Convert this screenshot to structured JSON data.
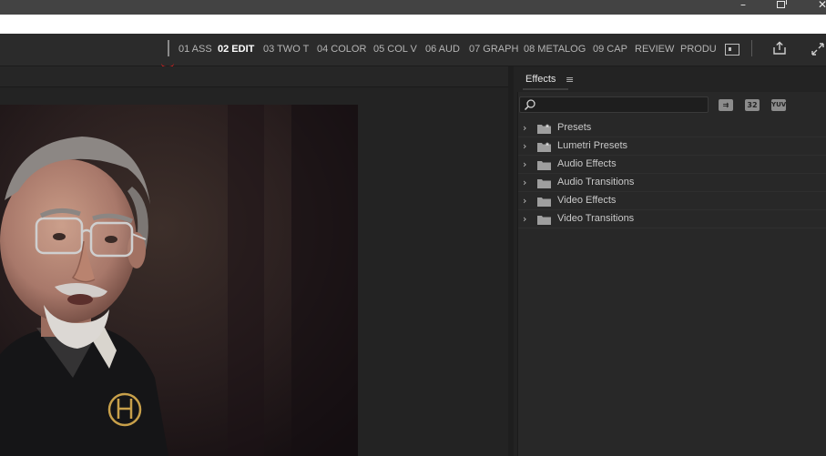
{
  "window": {
    "minimize_icon": "minimize-icon",
    "restore_icon": "restore-icon",
    "close_icon": "close-icon"
  },
  "workspaces": {
    "tabs": [
      {
        "label": "01 ASS",
        "active": false
      },
      {
        "label": "02 EDIT",
        "active": true
      },
      {
        "label": "03 TWO T",
        "active": false
      },
      {
        "label": "04 COLOR",
        "active": false
      },
      {
        "label": "05 COL V",
        "active": false
      },
      {
        "label": "06 AUD",
        "active": false
      },
      {
        "label": "07 GRAPH",
        "active": false
      },
      {
        "label": "08 METALOG",
        "active": false
      },
      {
        "label": "09 CAP",
        "active": false
      },
      {
        "label": "REVIEW",
        "active": false
      },
      {
        "label": "PRODU",
        "active": false
      }
    ],
    "accent_color": "#d81e1e"
  },
  "effects_panel": {
    "title": "Effects",
    "menu_glyph": "≡",
    "search": {
      "value": "",
      "placeholder": ""
    },
    "buttons": [
      {
        "name": "accelerated-effects-button",
        "label": "⇉"
      },
      {
        "name": "32bit-effects-button",
        "label": "32"
      },
      {
        "name": "yuv-effects-button",
        "label": "YUV"
      }
    ],
    "items": [
      {
        "label": "Presets",
        "icon": "preset-folder-icon"
      },
      {
        "label": "Lumetri Presets",
        "icon": "preset-folder-icon"
      },
      {
        "label": "Audio Effects",
        "icon": "folder-icon"
      },
      {
        "label": "Audio Transitions",
        "icon": "folder-icon"
      },
      {
        "label": "Video Effects",
        "icon": "folder-icon"
      },
      {
        "label": "Video Transitions",
        "icon": "folder-icon"
      }
    ]
  },
  "monitor": {
    "content": "video-frame"
  }
}
